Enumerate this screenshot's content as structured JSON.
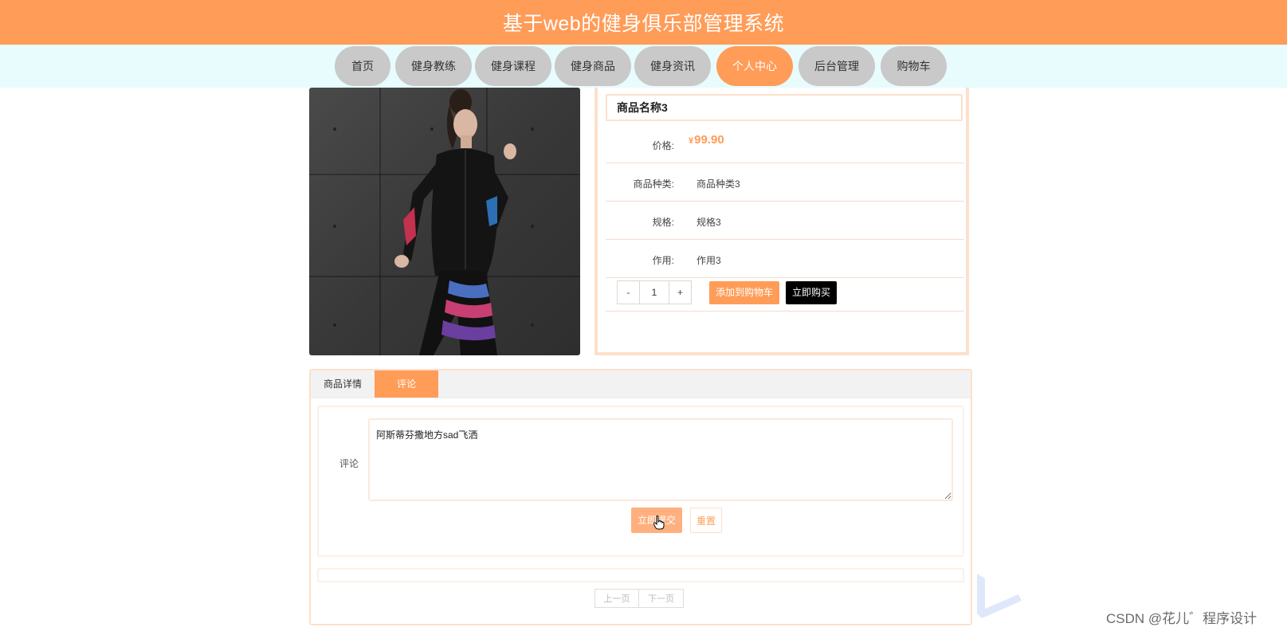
{
  "header": {
    "title": "基于web的健身俱乐部管理系统"
  },
  "nav": {
    "items": [
      {
        "label": "首页"
      },
      {
        "label": "健身教练"
      },
      {
        "label": "健身课程"
      },
      {
        "label": "健身商品"
      },
      {
        "label": "健身资讯"
      },
      {
        "label": "个人中心",
        "active": true
      },
      {
        "label": "后台管理"
      },
      {
        "label": "购物车"
      }
    ]
  },
  "product": {
    "name": "商品名称3",
    "price_label": "价格:",
    "currency": "¥",
    "price": "99.90",
    "category_label": "商品种类:",
    "category": "商品种类3",
    "spec_label": "规格:",
    "spec": "规格3",
    "effect_label": "作用:",
    "effect": "作用3",
    "quantity": "1",
    "minus_label": "-",
    "plus_label": "+",
    "add_to_cart_label": "添加到购物车",
    "buy_now_label": "立即购买"
  },
  "tabs": {
    "items": [
      {
        "label": "商品详情"
      },
      {
        "label": "评论",
        "active": true
      }
    ]
  },
  "comment": {
    "label": "评论",
    "value": "阿斯蒂芬撒地方sad飞洒",
    "submit_label": "立即提交",
    "reset_label": "重置"
  },
  "pagination": {
    "prev_label": "上一页",
    "next_label": "下一页"
  },
  "watermark": {
    "text": "CSDN @花儿゛程序设计"
  },
  "colors": {
    "accent": "#ff9c58",
    "nav_bg": "#e8fbfd",
    "pill_bg": "#c9c9c9",
    "border_tint": "#fde0cc"
  }
}
